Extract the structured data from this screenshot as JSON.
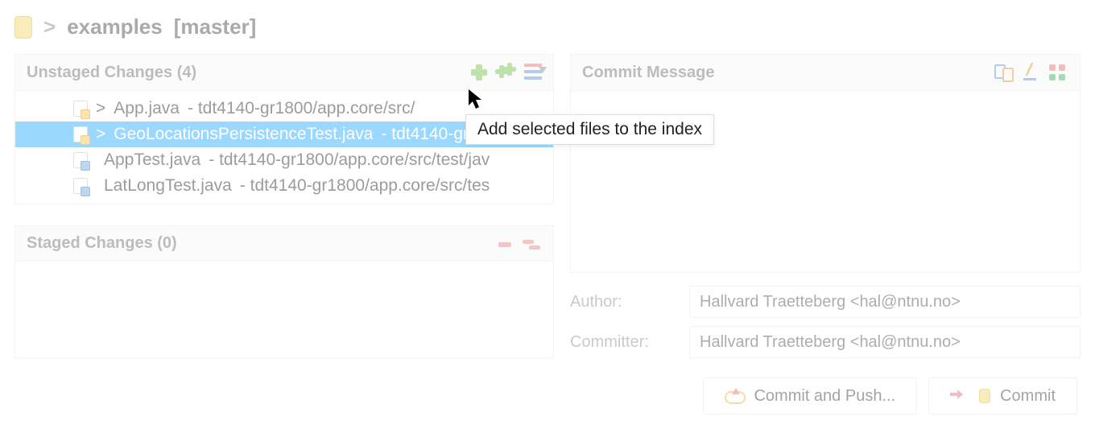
{
  "title": {
    "sep": ">",
    "repo": "examples",
    "branch": "[master]"
  },
  "unstaged": {
    "header": "Unstaged Changes (4)",
    "items": [
      {
        "prefix": "> ",
        "name": "App.java",
        "path": " - tdt4140-gr1800/app.core/src/",
        "selected": false,
        "modified": true
      },
      {
        "prefix": "> ",
        "name": "GeoLocationsPersistenceTest.java",
        "path": " - tdt4140-gr1800",
        "selected": true,
        "modified": true
      },
      {
        "prefix": "",
        "name": "AppTest.java",
        "path": " - tdt4140-gr1800/app.core/src/test/jav",
        "selected": false,
        "modified": false
      },
      {
        "prefix": "",
        "name": "LatLongTest.java",
        "path": " - tdt4140-gr1800/app.core/src/tes",
        "selected": false,
        "modified": false
      }
    ]
  },
  "staged": {
    "header": "Staged Changes (0)"
  },
  "commit": {
    "header": "Commit Message",
    "author_label": "Author:",
    "committer_label": "Committer:",
    "author": "Hallvard Traetteberg <hal@ntnu.no>",
    "committer": "Hallvard Traetteberg <hal@ntnu.no>",
    "commit_push": "Commit and Push...",
    "commit": "Commit"
  },
  "tooltip": "Add selected files to the index"
}
